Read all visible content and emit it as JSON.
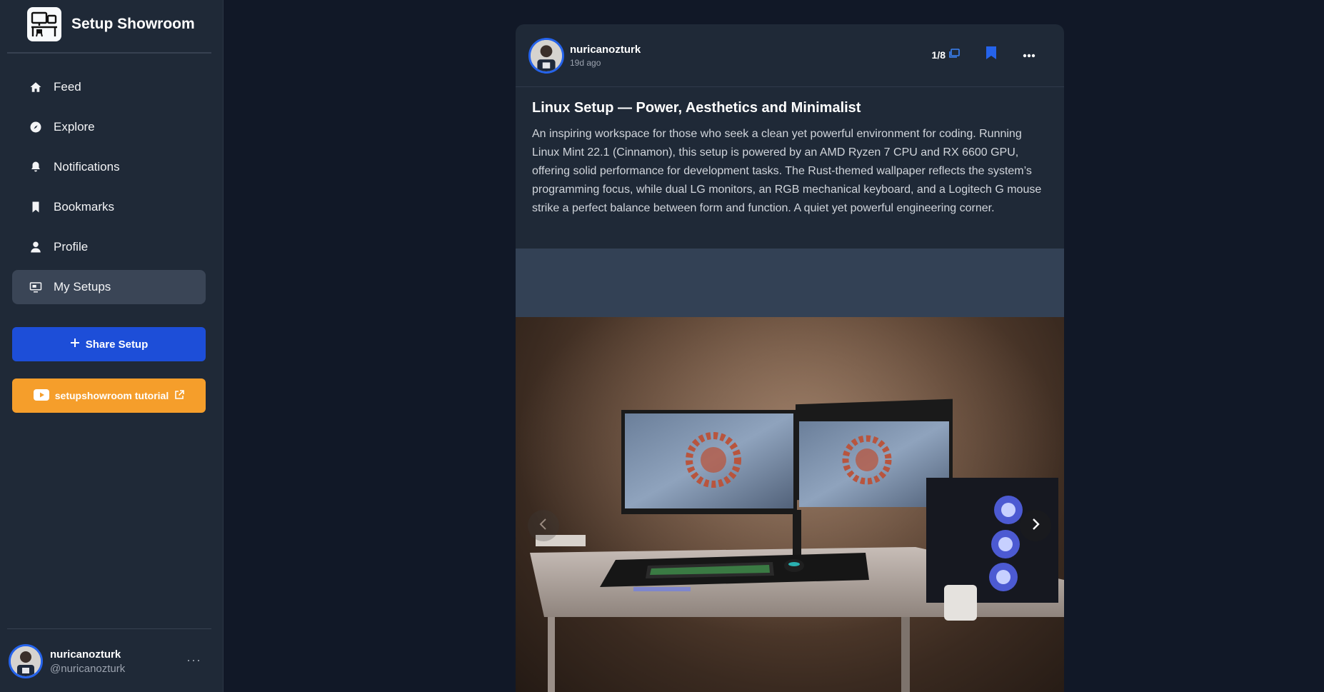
{
  "app": {
    "name": "Setup Showroom"
  },
  "nav": {
    "items": [
      {
        "label": "Feed",
        "icon": "home-icon"
      },
      {
        "label": "Explore",
        "icon": "compass-icon"
      },
      {
        "label": "Notifications",
        "icon": "bell-icon"
      },
      {
        "label": "Bookmarks",
        "icon": "bookmark-icon"
      },
      {
        "label": "Profile",
        "icon": "user-icon"
      },
      {
        "label": "My Setups",
        "icon": "monitor-icon",
        "active": true
      }
    ]
  },
  "actions": {
    "share_label": "Share Setup",
    "tutorial_label": "setupshowroom tutorial"
  },
  "current_user": {
    "name": "nuricanozturk",
    "handle": "@nuricanozturk"
  },
  "post": {
    "author": "nuricanozturk",
    "time": "19d ago",
    "image_counter": "1/8",
    "title": "Linux Setup — Power, Aesthetics and Minimalist",
    "description": "An inspiring workspace for those who seek a clean yet powerful environment for coding. Running Linux Mint 22.1 (Cinnamon), this setup is powered by an AMD Ryzen 7 CPU and RX 6600 GPU, offering solid performance for development tasks. The Rust-themed wallpaper reflects the system’s programming focus, while dual LG monitors, an RGB mechanical keyboard, and a Logitech G mouse strike a perfect balance between form and function. A quiet yet powerful engineering corner."
  },
  "colors": {
    "background": "#111827",
    "sidebar": "#1f2937",
    "accent_blue": "#1d4ed8",
    "accent_orange": "#f59e2b",
    "active_nav": "#3a4556"
  }
}
